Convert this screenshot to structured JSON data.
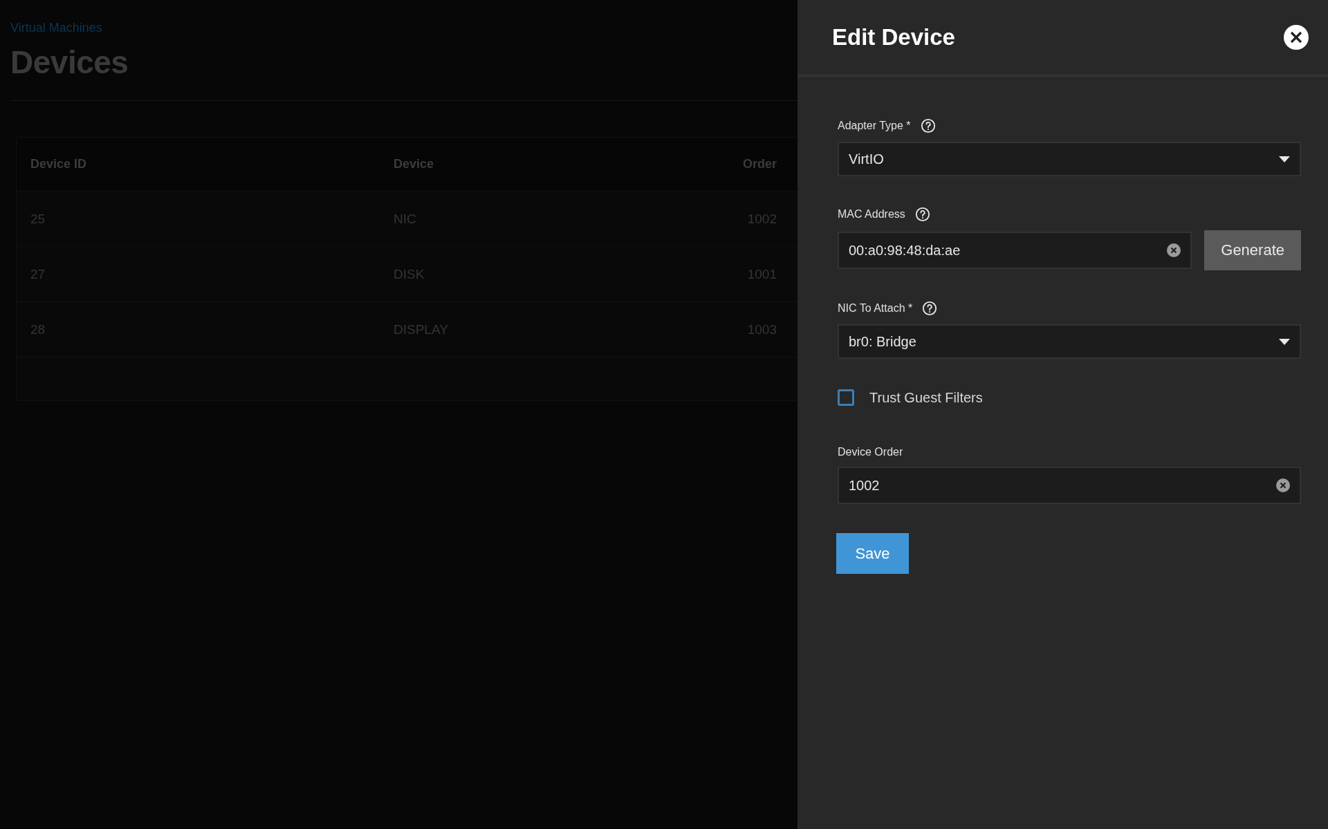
{
  "page": {
    "breadcrumb": "Virtual Machines",
    "title": "Devices",
    "table": {
      "columns": [
        "Device ID",
        "Device",
        "Order"
      ],
      "rows": [
        [
          "25",
          "NIC",
          "1002"
        ],
        [
          "27",
          "DISK",
          "1001"
        ],
        [
          "28",
          "DISPLAY",
          "1003"
        ]
      ]
    }
  },
  "panel": {
    "title": "Edit Device",
    "fields": [
      {
        "kind": "select",
        "label": "Adapter Type *",
        "help": true,
        "value": "VirtIO"
      },
      {
        "kind": "text",
        "label": "MAC Address",
        "help": true,
        "value": "00:a0:98:48:da:ae",
        "clearable": true,
        "button": "Generate"
      },
      {
        "kind": "select",
        "label": "NIC To Attach *",
        "help": true,
        "value": "br0: Bridge"
      },
      {
        "kind": "checkbox",
        "label": "Trust Guest Filters",
        "checked": false
      },
      {
        "kind": "text",
        "label": "Device Order",
        "help": false,
        "value": "1002",
        "clearable": true
      }
    ],
    "save_button": "Save"
  }
}
